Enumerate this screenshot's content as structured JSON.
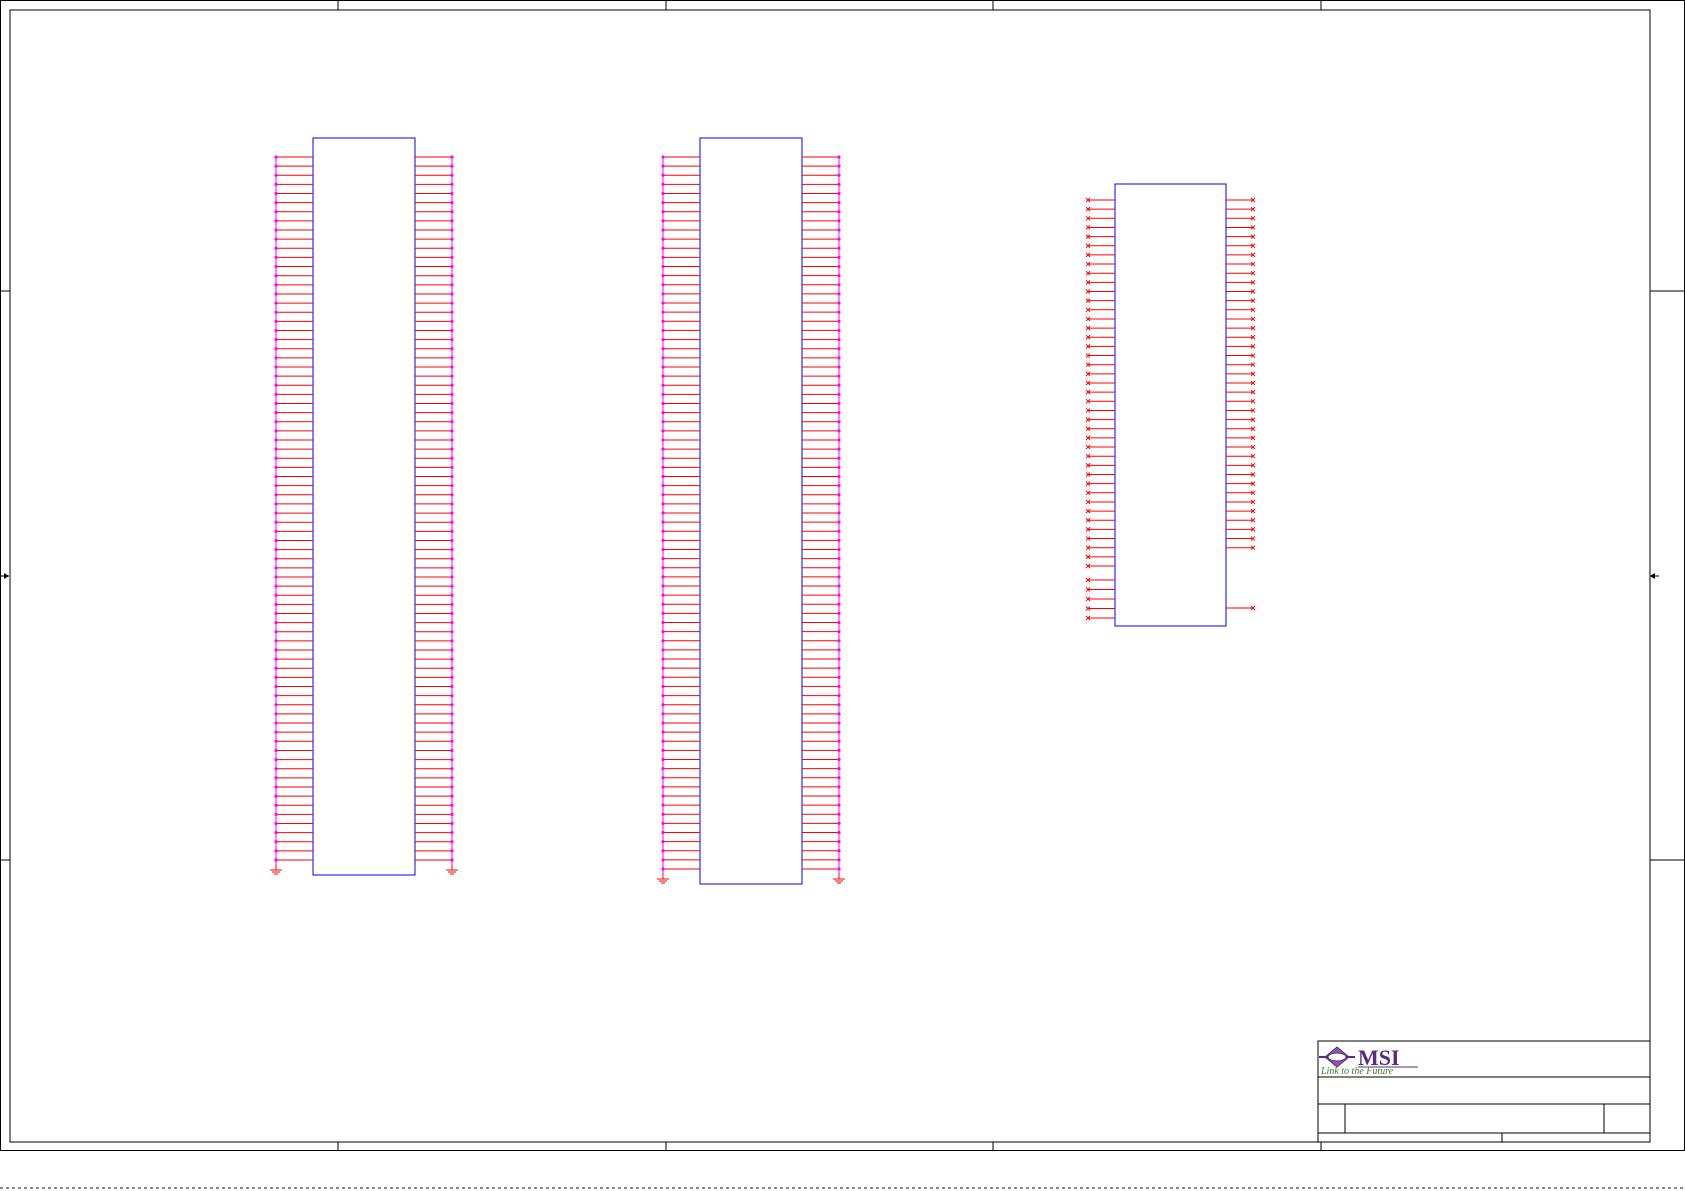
{
  "title_block": {
    "logo_brand": "MSI",
    "logo_tagline": "Link to the Future"
  },
  "colors": {
    "border": "#000000",
    "component_outline": "#0000ff",
    "pin_wire": "#ff0000",
    "pin_dot": "#ff00ff",
    "logo_purple": "#5a2a82",
    "logo_green": "#3a7d2a"
  },
  "components": [
    {
      "id": "connector-1",
      "type": "dual-row-connector",
      "pins_per_side": 78,
      "ground_symbols": 2
    },
    {
      "id": "connector-2",
      "type": "dual-row-connector",
      "pins_per_side": 79,
      "ground_symbols": 2
    },
    {
      "id": "ic-3",
      "type": "ic-block",
      "left_pins": 46,
      "right_pins": 40
    }
  ]
}
